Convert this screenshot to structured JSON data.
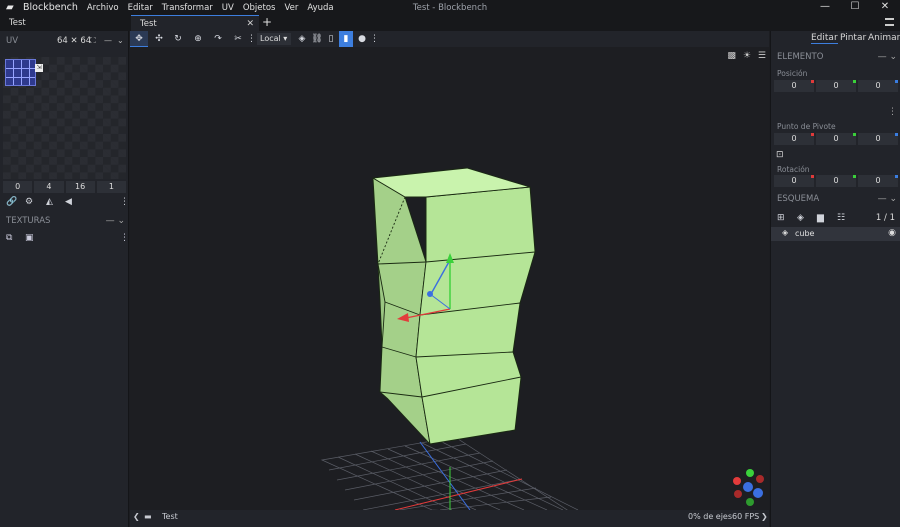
{
  "app": {
    "name": "Blockbench",
    "window_title": "Test - Blockbench"
  },
  "menu": [
    "Archivo",
    "Editar",
    "Transformar",
    "UV",
    "Objetos",
    "Ver",
    "Ayuda"
  ],
  "window_controls": {
    "minimize": "—",
    "maximize": "☐",
    "close": "✕"
  },
  "tabs": {
    "left": "Test",
    "main": "Test",
    "close": "✕",
    "add": "+"
  },
  "uv_panel": {
    "title": "UV",
    "size": "64 ✕ 64",
    "values": [
      "0",
      "4",
      "16",
      "1"
    ]
  },
  "textures_panel": {
    "title": "TEXTURAS"
  },
  "toolbar": {
    "space": "Local ▾"
  },
  "modes": [
    "Editar",
    "Pintar",
    "Animar"
  ],
  "element_panel": {
    "title": "ELEMENTO",
    "position_label": "Posición",
    "position": [
      "0",
      "0",
      "0"
    ],
    "pivot_label": "Punto de Pivote",
    "pivot": [
      "0",
      "0",
      "0"
    ],
    "rotation_label": "Rotación",
    "rotation": [
      "0",
      "0",
      "0"
    ]
  },
  "outliner": {
    "title": "ESQUEMA",
    "count": "1 / 1",
    "item": "cube"
  },
  "status": {
    "model": "Test",
    "axes": "0% de ejes",
    "fps": "60 FPS"
  },
  "colors": {
    "accent": "#3d7ede",
    "cube_fill": "#b5e597",
    "cube_edge": "#1a2a12",
    "axis_x": "#e23b3b",
    "axis_y": "#3bd13b",
    "axis_z": "#3b6fe0"
  }
}
